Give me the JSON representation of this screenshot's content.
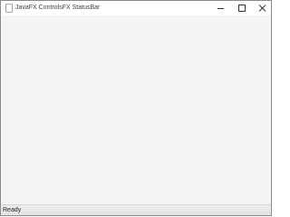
{
  "window": {
    "title": "JavaFX ControlsFX StatusBar",
    "controls": {
      "minimize_icon": "minimize-icon",
      "maximize_icon": "maximize-icon",
      "close_icon": "close-icon"
    }
  },
  "statusbar": {
    "text": "Ready"
  },
  "colors": {
    "content_background": "#f4f4f4",
    "statusbar_background": "#e8e8e8",
    "titlebar_background": "#ffffff"
  }
}
